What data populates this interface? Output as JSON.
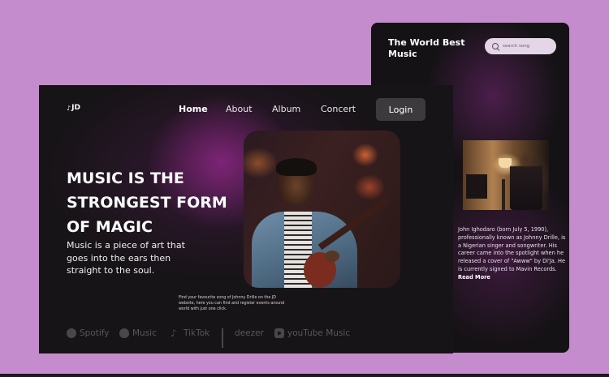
{
  "back_card": {
    "title": "The World Best Music",
    "search": {
      "placeholder": "search song",
      "icon": "search-icon"
    },
    "bio": {
      "text": "John Ighodaro (born July 5, 1990), professionally known as Johnny Drille, is a Nigerian singer and songwriter. His career came into the spotlight when he released a cover of \"Awww\" by Di'Ja. He is currently signed to Mavin Records.",
      "read_more": "Read More"
    }
  },
  "front_card": {
    "logo": {
      "text": "JD",
      "icon": "music-note-icon"
    },
    "nav": [
      "Home",
      "About",
      "Album",
      "Concert"
    ],
    "login": "Login",
    "headline": "MUSIC IS THE STRONGEST FORM OF MAGIC",
    "subhead": "Music is a piece of art that goes into the ears then straight to the soul.",
    "hero_caption": "Find your favourite song of Johnny Drille on the JD website, here you can find and register events around world with just one click.",
    "brands": [
      {
        "name": "Spotify",
        "icon": "spotify-icon"
      },
      {
        "name": "Music",
        "icon": "apple-icon"
      },
      {
        "name": "TikTok",
        "icon": "tiktok-icon"
      },
      {
        "name": "deezer",
        "icon": "deezer-icon"
      },
      {
        "name": "youTube Music",
        "icon": "youtube-music-icon"
      }
    ]
  },
  "colors": {
    "background": "#c48ccc",
    "card": "#171417",
    "accent": "#9a2c8c",
    "login_button": "#3d3a3e",
    "search_pill": "#e4d6e6"
  }
}
